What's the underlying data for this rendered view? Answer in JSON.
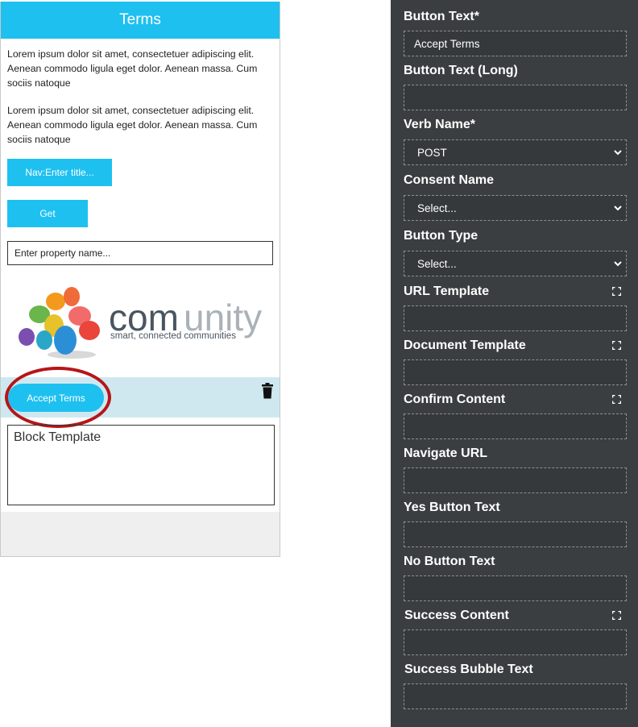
{
  "preview": {
    "header_title": "Terms",
    "paragraphs": [
      "Lorem ipsum dolor sit amet, consectetuer adipiscing elit. Aenean commodo ligula eget dolor. Aenean massa. Cum sociis natoque",
      "Lorem ipsum dolor sit amet, consectetuer adipiscing elit. Aenean commodo ligula eget dolor. Aenean massa. Cum sociis natoque"
    ],
    "nav_button": "Nav:Enter title...",
    "get_button": "Get",
    "property_input": "Enter property name...",
    "logo": {
      "name": "comunity",
      "tagline": "smart, connected communities"
    },
    "accept_button": "Accept Terms",
    "block_template": "Block Template",
    "colors": {
      "accent": "#1ec0f0",
      "highlight_circle": "#b51619",
      "selected_bg": "#cfe8f0"
    }
  },
  "panel": {
    "fields": [
      {
        "label": "Button Text*",
        "value": "Accept Terms",
        "type": "text"
      },
      {
        "label": "Button Text (Long)",
        "value": "",
        "type": "text"
      },
      {
        "label": "Verb Name*",
        "value": "POST",
        "type": "select"
      },
      {
        "label": "Consent Name",
        "value": "Select...",
        "type": "select"
      },
      {
        "label": "Button Type",
        "value": "Select...",
        "type": "select"
      },
      {
        "label": "URL Template",
        "value": "",
        "type": "text",
        "expandable": true
      },
      {
        "label": "Document Template",
        "value": "",
        "type": "text",
        "expandable": true
      },
      {
        "label": "Confirm Content",
        "value": "",
        "type": "text",
        "expandable": true
      },
      {
        "label": "Navigate URL",
        "value": "",
        "type": "text"
      },
      {
        "label": "Yes Button Text",
        "value": "",
        "type": "text"
      },
      {
        "label": "No Button Text",
        "value": "",
        "type": "text"
      },
      {
        "label": "Success Content",
        "value": "",
        "type": "text",
        "expandable": true
      },
      {
        "label": "Success Bubble Text",
        "value": "",
        "type": "text"
      }
    ]
  }
}
